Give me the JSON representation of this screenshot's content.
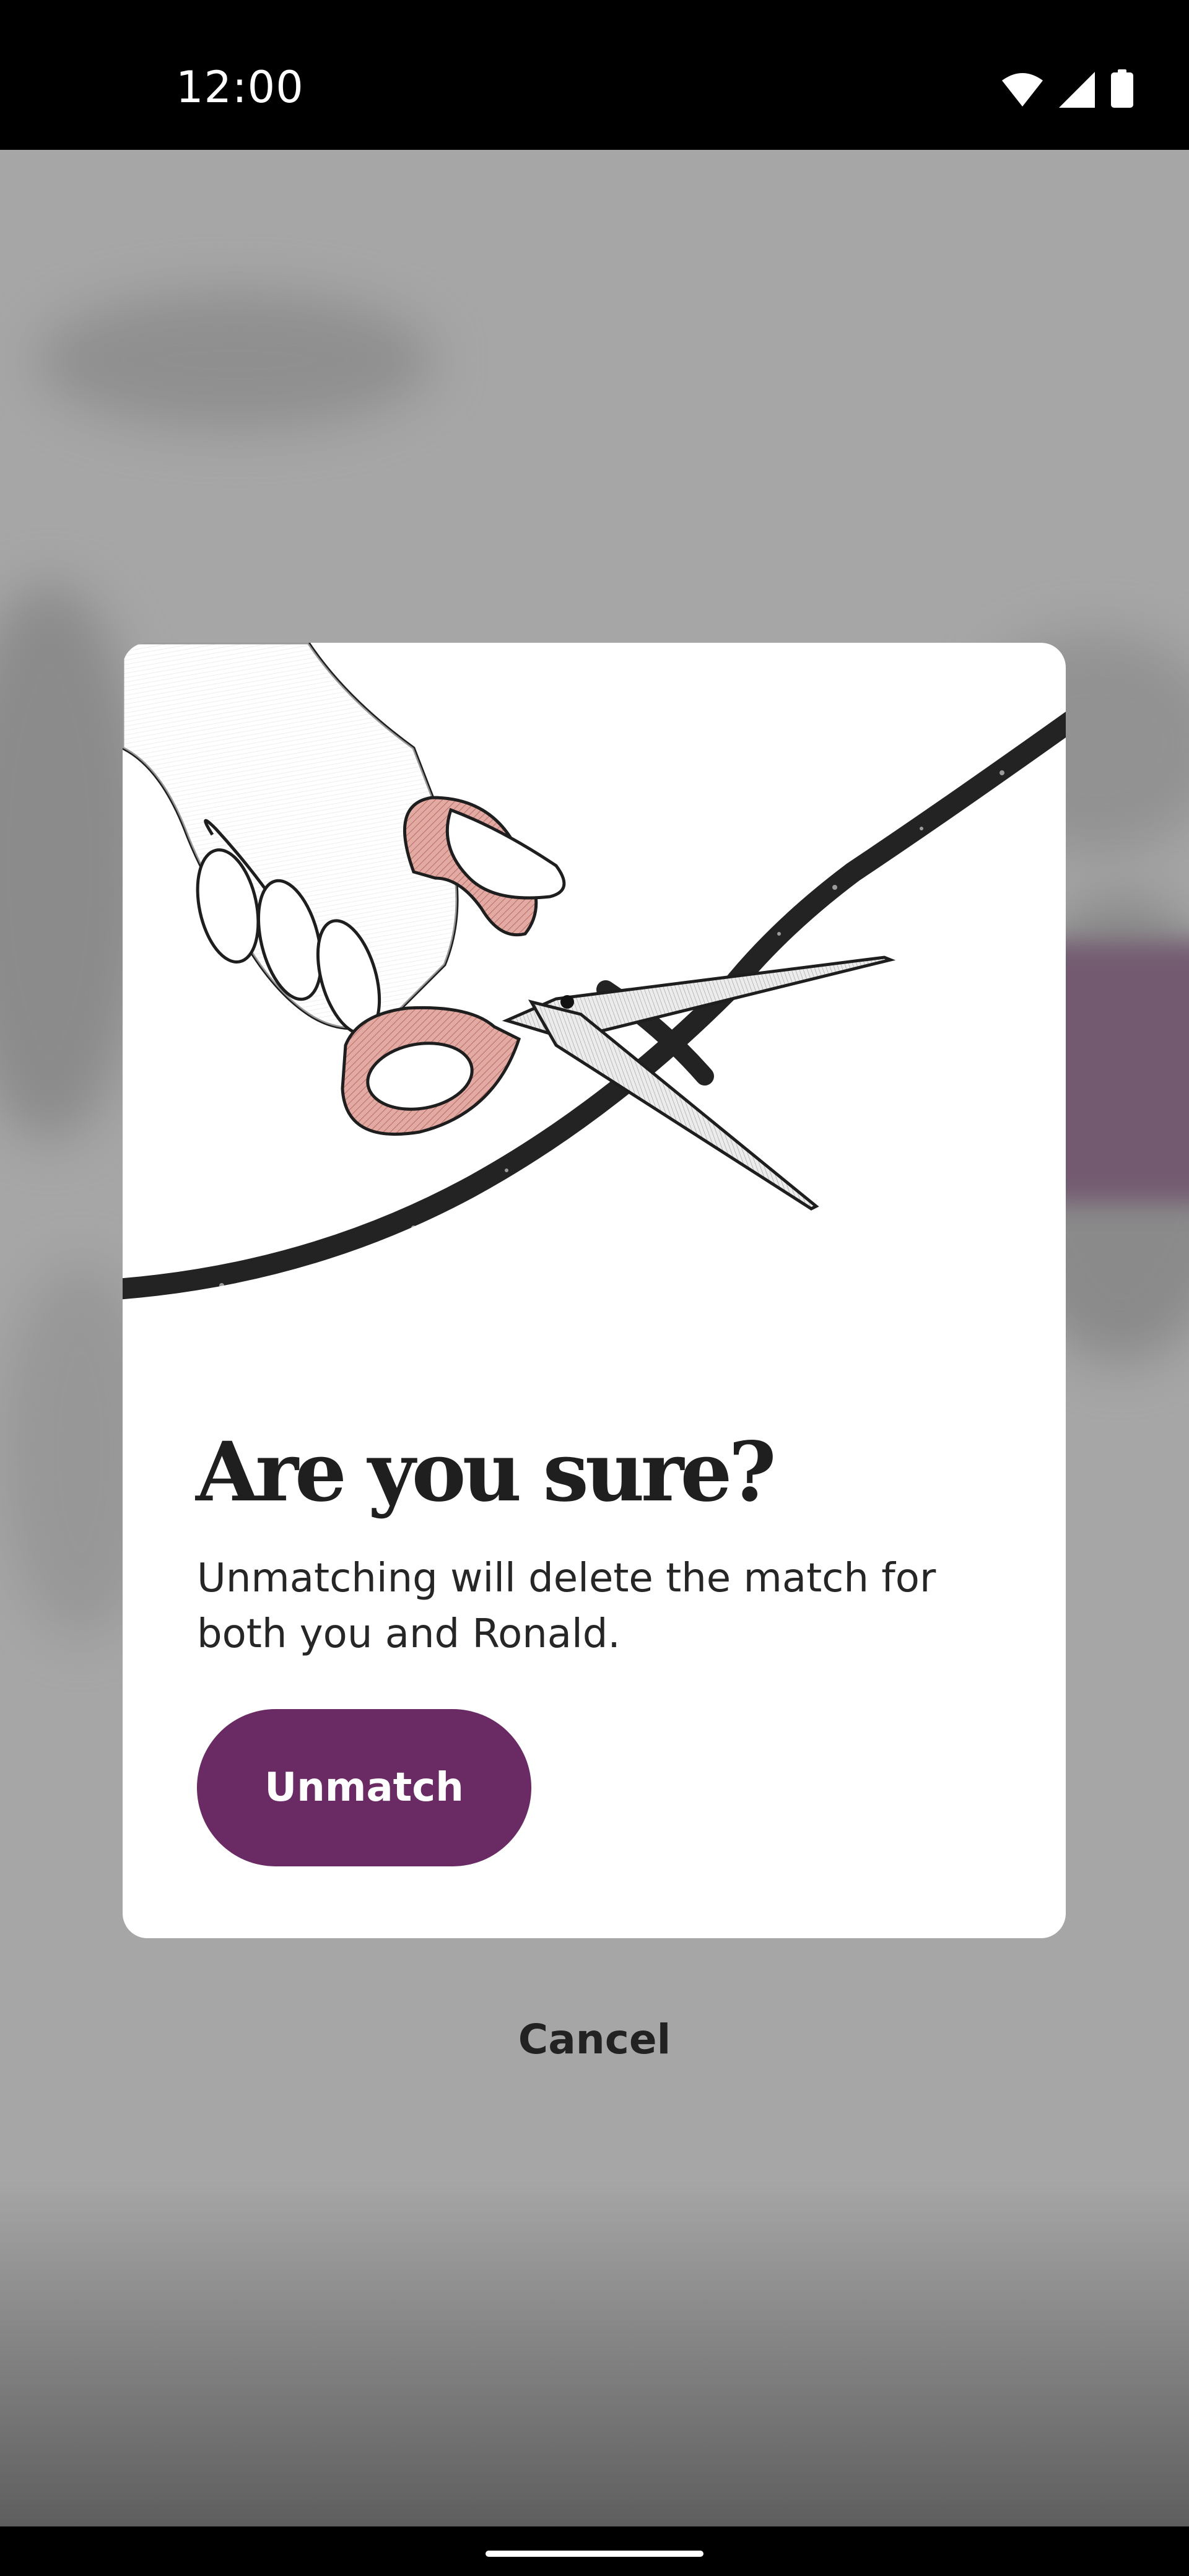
{
  "status_bar": {
    "time": "12:00",
    "icons": [
      "wifi-icon",
      "cell-signal-icon",
      "battery-icon"
    ]
  },
  "dialog": {
    "illustration": "scissors-cutting-thread-illustration",
    "title": "Are you sure?",
    "body": "Unmatching will delete the match for both you and Ronald.",
    "primary_button_label": "Unmatch"
  },
  "cancel_label": "Cancel",
  "colors": {
    "accent": "#6a2a63",
    "scrim": "#a5a5a5",
    "scissors_handle": "#d7a19b",
    "thread": "#222222"
  }
}
